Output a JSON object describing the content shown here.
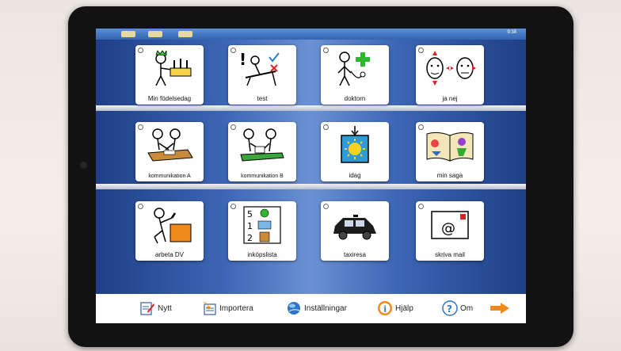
{
  "status_bar": {
    "time": "9:38"
  },
  "board": {
    "cells": [
      {
        "label": "Min födelsedag",
        "icon": "birthday-cake-icon"
      },
      {
        "label": "test",
        "icon": "test-icon"
      },
      {
        "label": "doktorn",
        "icon": "doctor-icon"
      },
      {
        "label": "ja nej",
        "icon": "yes-no-faces-icon"
      },
      {
        "label": "kommunikation A",
        "icon": "communication-a-icon"
      },
      {
        "label": "kommunikation B",
        "icon": "communication-b-icon"
      },
      {
        "label": "idag",
        "icon": "sun-today-icon"
      },
      {
        "label": "min saga",
        "icon": "storybook-icon"
      },
      {
        "label": "arbeta DV",
        "icon": "work-icon"
      },
      {
        "label": "inköpslista",
        "icon": "shopping-list-icon"
      },
      {
        "label": "taxiresa",
        "icon": "taxi-icon"
      },
      {
        "label": "skriva mail",
        "icon": "email-icon"
      }
    ]
  },
  "toolbar": {
    "new_label": "Nytt",
    "import_label": "Importera",
    "settings_label": "Inställningar",
    "help_label": "Hjälp",
    "about_label": "Om",
    "next_icon": "arrow-right-icon"
  },
  "colors": {
    "board_blue": "#3c66b5",
    "accent_orange": "#f08a1c",
    "device_bezel": "#121212"
  }
}
